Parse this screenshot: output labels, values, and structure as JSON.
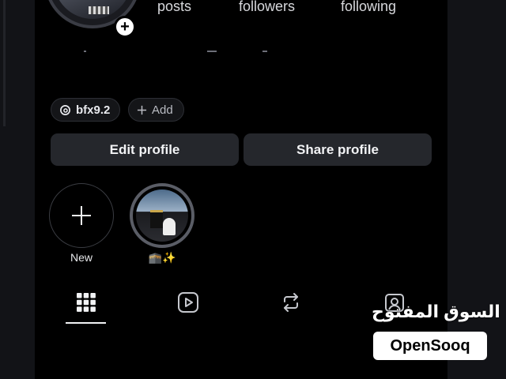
{
  "profile": {
    "stats": {
      "posts_label": "posts",
      "followers_label": "followers",
      "following_label": "following"
    },
    "threads_chip": {
      "icon": "threads-icon",
      "handle": "bfx9.2"
    },
    "add_chip": {
      "icon": "plus-icon",
      "label": "Add"
    },
    "edit_button": "Edit profile",
    "share_button": "Share profile"
  },
  "highlights": [
    {
      "label": "New",
      "icon": "plus-icon"
    },
    {
      "label": "🕋✨",
      "icon": "story-thumbnail"
    }
  ],
  "tabs": [
    {
      "icon": "grid-icon",
      "active": true
    },
    {
      "icon": "reels-icon",
      "active": false
    },
    {
      "icon": "repost-icon",
      "active": false
    },
    {
      "icon": "tagged-icon",
      "active": false
    }
  ],
  "watermark": {
    "arabic": "السوق المفتوح",
    "latin": "OpenSooq"
  },
  "colors": {
    "background": "#000000",
    "button": "#25272c",
    "text": "#f2f3f5"
  }
}
